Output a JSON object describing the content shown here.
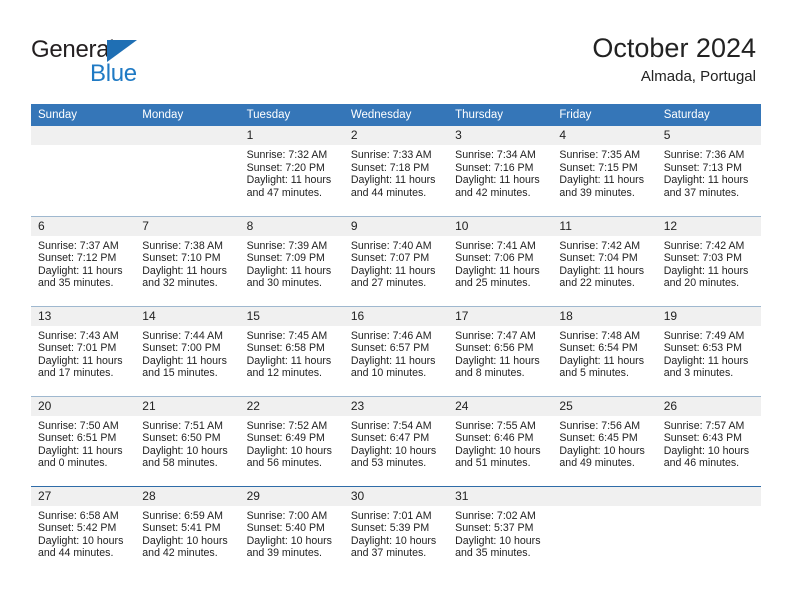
{
  "brand": {
    "name_top": "General",
    "name_bottom": "Blue",
    "triangle_color": "#1f6fb4",
    "text_color": "#231f20",
    "blue_color": "#1f7ac4"
  },
  "header": {
    "title": "October 2024",
    "subtitle": "Almada, Portugal"
  },
  "colors": {
    "header_bar": "#3576b8",
    "daynum_band": "#f0f0f0",
    "grid_line": "#9fb8cf",
    "text": "#222222"
  },
  "weekdays": [
    "Sunday",
    "Monday",
    "Tuesday",
    "Wednesday",
    "Thursday",
    "Friday",
    "Saturday"
  ],
  "labels": {
    "sunrise_prefix": "Sunrise: ",
    "sunset_prefix": "Sunset: ",
    "daylight_prefix": "Daylight: "
  },
  "weeks": [
    [
      {
        "day": "",
        "empty": true
      },
      {
        "day": "",
        "empty": true
      },
      {
        "day": "1",
        "sunrise": "Sunrise: 7:32 AM",
        "sunset": "Sunset: 7:20 PM",
        "daylight": "Daylight: 11 hours and 47 minutes."
      },
      {
        "day": "2",
        "sunrise": "Sunrise: 7:33 AM",
        "sunset": "Sunset: 7:18 PM",
        "daylight": "Daylight: 11 hours and 44 minutes."
      },
      {
        "day": "3",
        "sunrise": "Sunrise: 7:34 AM",
        "sunset": "Sunset: 7:16 PM",
        "daylight": "Daylight: 11 hours and 42 minutes."
      },
      {
        "day": "4",
        "sunrise": "Sunrise: 7:35 AM",
        "sunset": "Sunset: 7:15 PM",
        "daylight": "Daylight: 11 hours and 39 minutes."
      },
      {
        "day": "5",
        "sunrise": "Sunrise: 7:36 AM",
        "sunset": "Sunset: 7:13 PM",
        "daylight": "Daylight: 11 hours and 37 minutes."
      }
    ],
    [
      {
        "day": "6",
        "sunrise": "Sunrise: 7:37 AM",
        "sunset": "Sunset: 7:12 PM",
        "daylight": "Daylight: 11 hours and 35 minutes."
      },
      {
        "day": "7",
        "sunrise": "Sunrise: 7:38 AM",
        "sunset": "Sunset: 7:10 PM",
        "daylight": "Daylight: 11 hours and 32 minutes."
      },
      {
        "day": "8",
        "sunrise": "Sunrise: 7:39 AM",
        "sunset": "Sunset: 7:09 PM",
        "daylight": "Daylight: 11 hours and 30 minutes."
      },
      {
        "day": "9",
        "sunrise": "Sunrise: 7:40 AM",
        "sunset": "Sunset: 7:07 PM",
        "daylight": "Daylight: 11 hours and 27 minutes."
      },
      {
        "day": "10",
        "sunrise": "Sunrise: 7:41 AM",
        "sunset": "Sunset: 7:06 PM",
        "daylight": "Daylight: 11 hours and 25 minutes."
      },
      {
        "day": "11",
        "sunrise": "Sunrise: 7:42 AM",
        "sunset": "Sunset: 7:04 PM",
        "daylight": "Daylight: 11 hours and 22 minutes."
      },
      {
        "day": "12",
        "sunrise": "Sunrise: 7:42 AM",
        "sunset": "Sunset: 7:03 PM",
        "daylight": "Daylight: 11 hours and 20 minutes."
      }
    ],
    [
      {
        "day": "13",
        "sunrise": "Sunrise: 7:43 AM",
        "sunset": "Sunset: 7:01 PM",
        "daylight": "Daylight: 11 hours and 17 minutes."
      },
      {
        "day": "14",
        "sunrise": "Sunrise: 7:44 AM",
        "sunset": "Sunset: 7:00 PM",
        "daylight": "Daylight: 11 hours and 15 minutes."
      },
      {
        "day": "15",
        "sunrise": "Sunrise: 7:45 AM",
        "sunset": "Sunset: 6:58 PM",
        "daylight": "Daylight: 11 hours and 12 minutes."
      },
      {
        "day": "16",
        "sunrise": "Sunrise: 7:46 AM",
        "sunset": "Sunset: 6:57 PM",
        "daylight": "Daylight: 11 hours and 10 minutes."
      },
      {
        "day": "17",
        "sunrise": "Sunrise: 7:47 AM",
        "sunset": "Sunset: 6:56 PM",
        "daylight": "Daylight: 11 hours and 8 minutes."
      },
      {
        "day": "18",
        "sunrise": "Sunrise: 7:48 AM",
        "sunset": "Sunset: 6:54 PM",
        "daylight": "Daylight: 11 hours and 5 minutes."
      },
      {
        "day": "19",
        "sunrise": "Sunrise: 7:49 AM",
        "sunset": "Sunset: 6:53 PM",
        "daylight": "Daylight: 11 hours and 3 minutes."
      }
    ],
    [
      {
        "day": "20",
        "sunrise": "Sunrise: 7:50 AM",
        "sunset": "Sunset: 6:51 PM",
        "daylight": "Daylight: 11 hours and 0 minutes."
      },
      {
        "day": "21",
        "sunrise": "Sunrise: 7:51 AM",
        "sunset": "Sunset: 6:50 PM",
        "daylight": "Daylight: 10 hours and 58 minutes."
      },
      {
        "day": "22",
        "sunrise": "Sunrise: 7:52 AM",
        "sunset": "Sunset: 6:49 PM",
        "daylight": "Daylight: 10 hours and 56 minutes."
      },
      {
        "day": "23",
        "sunrise": "Sunrise: 7:54 AM",
        "sunset": "Sunset: 6:47 PM",
        "daylight": "Daylight: 10 hours and 53 minutes."
      },
      {
        "day": "24",
        "sunrise": "Sunrise: 7:55 AM",
        "sunset": "Sunset: 6:46 PM",
        "daylight": "Daylight: 10 hours and 51 minutes."
      },
      {
        "day": "25",
        "sunrise": "Sunrise: 7:56 AM",
        "sunset": "Sunset: 6:45 PM",
        "daylight": "Daylight: 10 hours and 49 minutes."
      },
      {
        "day": "26",
        "sunrise": "Sunrise: 7:57 AM",
        "sunset": "Sunset: 6:43 PM",
        "daylight": "Daylight: 10 hours and 46 minutes."
      }
    ],
    [
      {
        "day": "27",
        "sunrise": "Sunrise: 6:58 AM",
        "sunset": "Sunset: 5:42 PM",
        "daylight": "Daylight: 10 hours and 44 minutes."
      },
      {
        "day": "28",
        "sunrise": "Sunrise: 6:59 AM",
        "sunset": "Sunset: 5:41 PM",
        "daylight": "Daylight: 10 hours and 42 minutes."
      },
      {
        "day": "29",
        "sunrise": "Sunrise: 7:00 AM",
        "sunset": "Sunset: 5:40 PM",
        "daylight": "Daylight: 10 hours and 39 minutes."
      },
      {
        "day": "30",
        "sunrise": "Sunrise: 7:01 AM",
        "sunset": "Sunset: 5:39 PM",
        "daylight": "Daylight: 10 hours and 37 minutes."
      },
      {
        "day": "31",
        "sunrise": "Sunrise: 7:02 AM",
        "sunset": "Sunset: 5:37 PM",
        "daylight": "Daylight: 10 hours and 35 minutes."
      },
      {
        "day": "",
        "empty": true
      },
      {
        "day": "",
        "empty": true
      }
    ]
  ]
}
